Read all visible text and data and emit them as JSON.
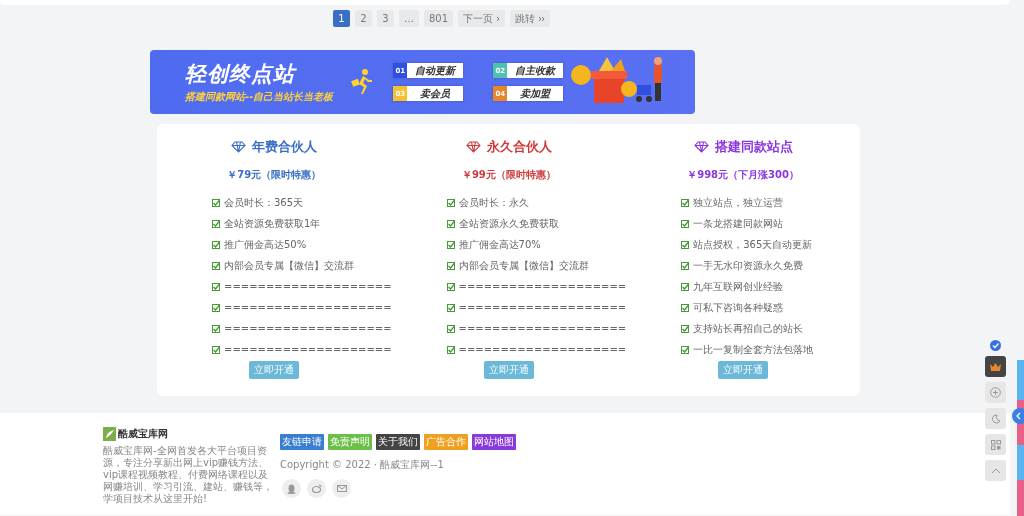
{
  "pagination": [
    {
      "label": "1",
      "kind": "page",
      "selected": true
    },
    {
      "label": "2",
      "kind": "page",
      "selected": false
    },
    {
      "label": "3",
      "kind": "page",
      "selected": false
    },
    {
      "label": "…",
      "kind": "gap",
      "selected": false
    },
    {
      "label": "801",
      "kind": "page",
      "selected": false
    },
    {
      "label": "下一页",
      "kind": "next",
      "selected": false
    },
    {
      "label": "跳转",
      "kind": "jump",
      "selected": false
    }
  ],
  "banner": {
    "title": "轻创终点站",
    "subtitle": "搭建同款网站--自己当站长当老板",
    "features": [
      {
        "number": "01",
        "label": "自动更新",
        "color": "#2f4fe0"
      },
      {
        "number": "02",
        "label": "自主收款",
        "color": "#4cc3b0"
      },
      {
        "number": "03",
        "label": "卖会员",
        "color": "#f2c230"
      },
      {
        "number": "04",
        "label": "卖加盟",
        "color": "#e8862a"
      }
    ]
  },
  "plans": [
    {
      "name": "年费合伙人",
      "price": "￥79元（限时特惠）",
      "color": "#3a6fc4",
      "features": [
        "会员时长：365天",
        "全站资源免费获取1年",
        "推广佣金高达50%",
        "内部会员专属【微信】交流群",
        "====================",
        "====================",
        "====================",
        "===================="
      ],
      "button": "立即开通"
    },
    {
      "name": "永久合伙人",
      "price": "￥99元（限时特惠）",
      "color": "#d0393a",
      "features": [
        "会员时长：永久",
        "全站资源永久免费获取",
        "推广佣金高达70%",
        "内部会员专属【微信】交流群",
        "====================",
        "====================",
        "====================",
        "===================="
      ],
      "button": "立即开通"
    },
    {
      "name": "搭建同款站点",
      "price": "￥998元（下月涨300）",
      "color": "#8a35de",
      "features": [
        "独立站点，独立运营",
        "一条龙搭建同款网站",
        "站点授权，365天自动更新",
        "一手无水印资源永久免费",
        "九年互联网创业经验",
        "可私下咨询各种疑惑",
        "支持站长再招自己的站长",
        "一比一复制全套方法包落地"
      ],
      "button": "立即开通"
    }
  ],
  "footer": {
    "logo": "酷威宝库网",
    "description": "酷威宝库网-全网首发各大平台项目资源，专注分享新出网上vip赚钱方法、vip课程视频教程、付费网络课程以及网赚培训、学习引流、建站、赚钱等，学项目技术从这里开始!",
    "links": [
      {
        "label": "友链申请",
        "color": "#3a7fcf"
      },
      {
        "label": "免责声明",
        "color": "#6cc04a"
      },
      {
        "label": "关于我们",
        "color": "#444444"
      },
      {
        "label": "广告合作",
        "color": "#f0a020"
      },
      {
        "label": "网站地图",
        "color": "#8a3ad8"
      }
    ],
    "copyright": "Copyright © 2022 · 酷威宝库网--1"
  }
}
